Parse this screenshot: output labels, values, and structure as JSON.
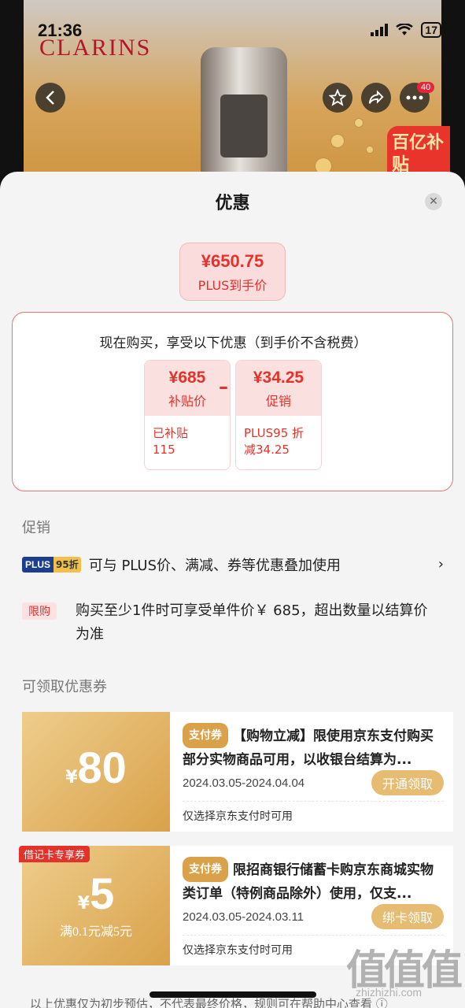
{
  "status_bar": {
    "time": "21:36",
    "battery": "17"
  },
  "background": {
    "brand": "CLARINS",
    "badge_count": "40",
    "subsidy_tag": "百亿补贴"
  },
  "sheet": {
    "title": "优惠",
    "close_icon": "close-icon",
    "final_price": {
      "amount": "¥650.75",
      "label": "PLUS到手价"
    },
    "breakdown": {
      "intro": "现在购买，享受以下优惠（到手价不含税费）",
      "subsidy": {
        "value": "¥685",
        "label": "补贴价",
        "note_line1": "已补贴",
        "note_line2": "115"
      },
      "operator": "–",
      "promo": {
        "value": "¥34.25",
        "label": "促销",
        "note_line1": "PLUS95 折",
        "note_line2": "减34.25"
      }
    },
    "promotions": {
      "section_label": "促销",
      "items": [
        {
          "badge_a": "PLUS",
          "badge_b": "95折",
          "text": "可与 PLUS价、满减、券等优惠叠加使用",
          "chevron": "›"
        },
        {
          "badge": "限购",
          "text": "购买至少1件时可享受单件价￥ 685，超出数量以结算价为准"
        }
      ]
    },
    "coupons": {
      "section_label": "可领取优惠券",
      "items": [
        {
          "currency": "¥",
          "amount": "80",
          "condition": "",
          "type": "支付券",
          "desc": "【购物立减】限使用京东支付购买部分实物商品可用，以收银台结算为...",
          "date": "2024.03.05-2024.04.04",
          "button": "开通领取",
          "note": "仅选择京东支付时可用"
        },
        {
          "tag": "借记卡专享券",
          "currency": "¥",
          "amount": "5",
          "condition": "满0.1元减5元",
          "type": "支付券",
          "desc": "限招商银行储蓄卡购京东商城实物类订单（特例商品除外）使用，仅支...",
          "date": "2024.03.05-2024.03.11",
          "button": "绑卡领取",
          "note": "仅选择京东支付时可用"
        }
      ]
    },
    "footnote": "以上优惠仅为初步预估，不代表最终价格，规则可在帮助中心查看 ⓘ"
  },
  "watermark": {
    "main": "值值值",
    "sub": "zhizhizhi.com"
  },
  "colors": {
    "accent_red": "#e4322b",
    "coupon_gold": "#d9a24a",
    "plus_blue": "#1d3d8f"
  }
}
